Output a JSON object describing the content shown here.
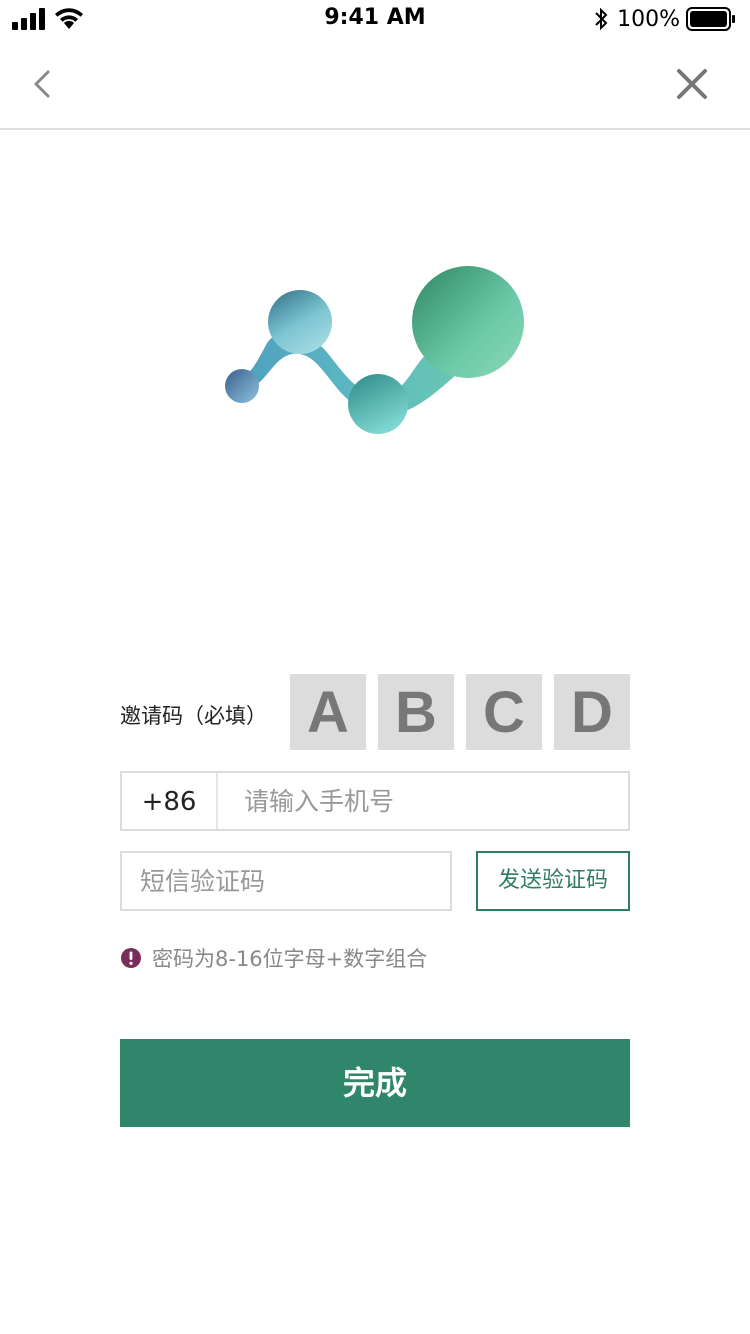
{
  "status_bar": {
    "time": "9:41 AM",
    "battery": "100%",
    "icons": [
      "signal-icon",
      "wifi-icon",
      "bluetooth-icon",
      "battery-icon"
    ]
  },
  "nav": {
    "back_icon": "chevron-left-icon",
    "close_icon": "close-icon"
  },
  "logo": {
    "icon": "molecule-logo"
  },
  "form": {
    "invite_label": "邀请码（必填）",
    "captcha_chars": [
      "A",
      "B",
      "C",
      "D"
    ],
    "country_code": "+86",
    "phone_placeholder": "请输入手机号",
    "phone_value": "",
    "sms_placeholder": "短信验证码",
    "sms_value": "",
    "send_code_label": "发送验证码",
    "hint_icon": "exclamation-circle-icon",
    "hint_text": "密码为8-16位字母+数字组合",
    "submit_label": "完成"
  },
  "colors": {
    "accent": "#30866a",
    "send_border": "#2f7d63",
    "hint_icon": "#7b2d5a",
    "captcha_bg": "#dcdcdc",
    "border": "#dcdcdc"
  }
}
